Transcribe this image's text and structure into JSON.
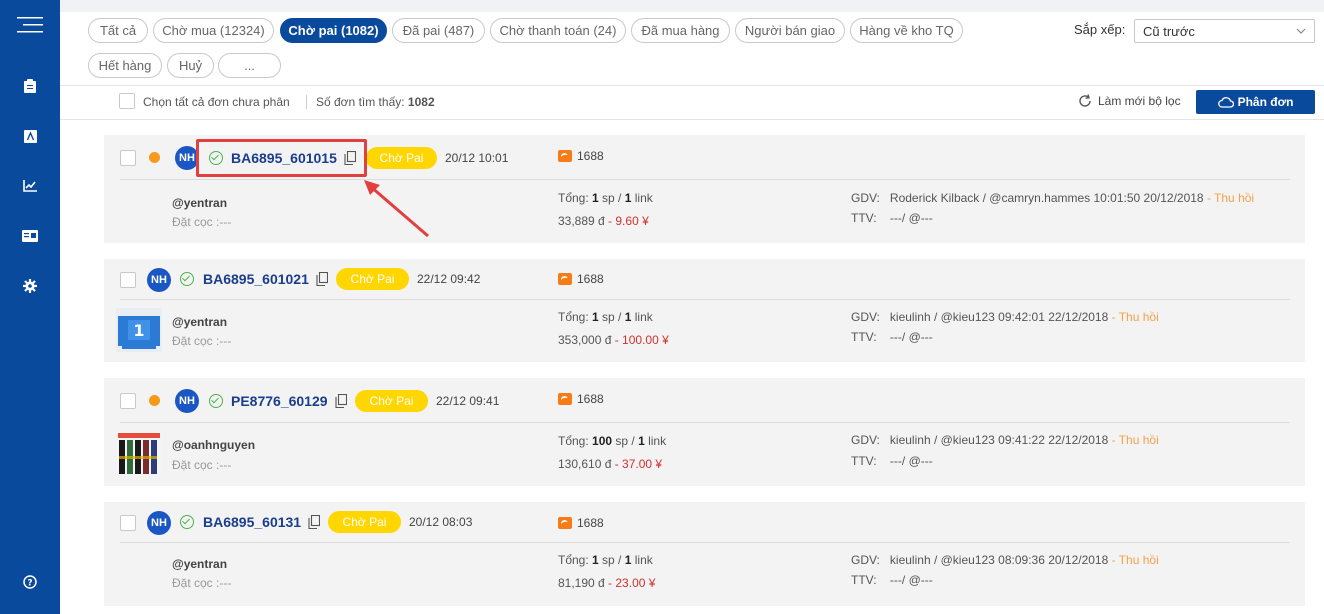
{
  "sidebar": {
    "items": [
      {
        "icon": "menu-icon"
      },
      {
        "icon": "clipboard-icon"
      },
      {
        "icon": "text-box-icon"
      },
      {
        "icon": "chart-icon"
      },
      {
        "icon": "card-icon"
      },
      {
        "icon": "gear-icon"
      },
      {
        "icon": "help-icon"
      }
    ]
  },
  "filters": {
    "chips": [
      {
        "label": "Tất cả"
      },
      {
        "label": "Chờ mua (12324)"
      },
      {
        "label": "Chờ pai (1082)"
      },
      {
        "label": "Đã pai (487)"
      },
      {
        "label": "Chờ thanh toán (24)"
      },
      {
        "label": "Đã mua hàng"
      },
      {
        "label": "Người bán giao"
      },
      {
        "label": "Hàng về kho TQ"
      },
      {
        "label": "Hết hàng"
      },
      {
        "label": "Huỷ"
      },
      {
        "label": "..."
      }
    ],
    "active_index": 2
  },
  "sort": {
    "label": "Sắp xếp:",
    "value": "Cũ trước"
  },
  "toolbar": {
    "select_all_label": "Chọn tất cả đơn chưa phân",
    "found_label": "Số đơn tìm thấy:",
    "found_count": "1082",
    "refresh_label": "Làm mới bộ lọc",
    "split_label": "Phân đơn"
  },
  "orders": [
    {
      "avatar": "NH",
      "has_dot": true,
      "code": "BA6895_601015",
      "status": "Chờ Pai",
      "time": "20/12 10:01",
      "source": "1688",
      "user": "@yentran",
      "deposit": "Đặt cọc :---",
      "total_prefix": "Tổng: ",
      "qty": "1",
      "qty_unit": " sp / ",
      "links": "1",
      "links_unit": " link",
      "vnd": "33,889 đ",
      "cny": " - 9.60 ¥",
      "gdv": "GDV:",
      "gdv_value": "Roderick Kilback / @camryn.hammes 10:01:50 20/12/2018",
      "recall": " - Thu hồi",
      "ttv": "TTV:",
      "ttv_value": "---/ @---",
      "thumb": "none"
    },
    {
      "avatar": "NH",
      "has_dot": false,
      "code": "BA6895_601021",
      "status": "Chờ Pai",
      "time": "22/12 09:42",
      "source": "1688",
      "user": "@yentran",
      "deposit": "Đặt cọc :---",
      "total_prefix": "Tổng: ",
      "qty": "1",
      "qty_unit": " sp / ",
      "links": "1",
      "links_unit": " link",
      "vnd": "353,000 đ",
      "cny": " - 100.00 ¥",
      "gdv": "GDV:",
      "gdv_value": "kieulinh / @kieu123 09:42:01 22/12/2018",
      "recall": " - Thu hồi",
      "ttv": "TTV:",
      "ttv_value": "---/ @---",
      "thumb": "blue-card"
    },
    {
      "avatar": "NH",
      "has_dot": true,
      "code": "PE8776_60129",
      "status": "Chờ Pai",
      "time": "22/12 09:41",
      "source": "1688",
      "user": "@oanhnguyen",
      "deposit": "Đặt cọc :---",
      "total_prefix": "Tổng: ",
      "qty": "100",
      "qty_unit": " sp / ",
      "links": "1",
      "links_unit": " link",
      "vnd": "130,610 đ",
      "cny": " - 37.00 ¥",
      "gdv": "GDV:",
      "gdv_value": "kieulinh / @kieu123 09:41:22 22/12/2018",
      "recall": " - Thu hồi",
      "ttv": "TTV:",
      "ttv_value": "---/ @---",
      "thumb": "pens"
    },
    {
      "avatar": "NH",
      "has_dot": false,
      "code": "BA6895_60131",
      "status": "Chờ Pai",
      "time": "20/12 08:03",
      "source": "1688",
      "user": "@yentran",
      "deposit": "Đặt cọc :---",
      "total_prefix": "Tổng: ",
      "qty": "1",
      "qty_unit": " sp / ",
      "links": "1",
      "links_unit": " link",
      "vnd": "81,190 đ",
      "cny": " - 23.00 ¥",
      "gdv": "GDV:",
      "gdv_value": "kieulinh / @kieu123 08:09:36 20/12/2018",
      "recall": " - Thu hồi",
      "ttv": "TTV:",
      "ttv_value": "---/ @---",
      "thumb": "none"
    }
  ],
  "colors": {
    "brand": "#0a4a9c",
    "status_yellow": "#ffd600",
    "recall_orange": "#f5a04a",
    "cny_red": "#d2312d",
    "highlight_red": "#e04040"
  }
}
